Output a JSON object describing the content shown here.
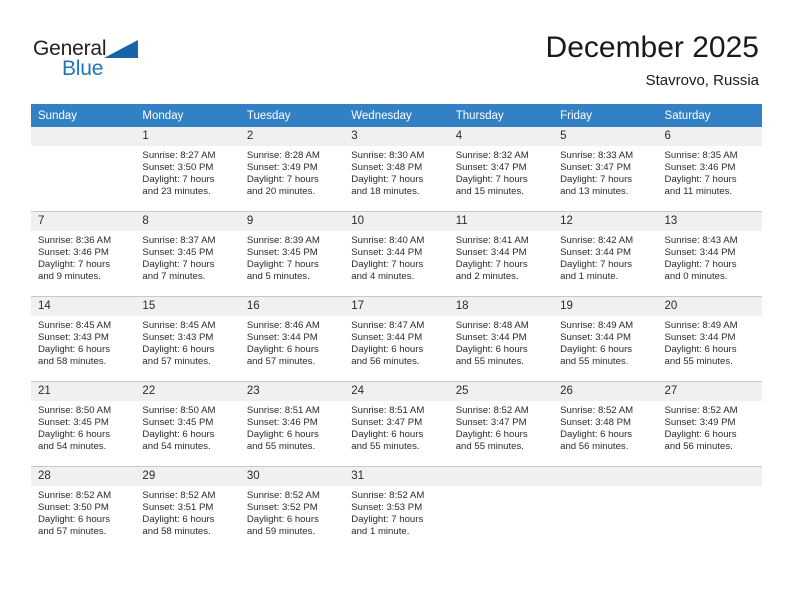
{
  "brand": {
    "line1": "General",
    "line2": "Blue",
    "triangle_icon": "triangle-right-icon",
    "color_text": "#231f20",
    "color_blue": "#1f74bd"
  },
  "header": {
    "title": "December 2025",
    "subtitle": "Stavrovo, Russia"
  },
  "theme": {
    "header_bg": "#3281c4",
    "header_text": "#ffffff",
    "daynum_bg": "#f0f0f0",
    "grid_line": "#c8c8c8",
    "body_text": "#2b2b2b"
  },
  "weekday_headers": [
    "Sunday",
    "Monday",
    "Tuesday",
    "Wednesday",
    "Thursday",
    "Friday",
    "Saturday"
  ],
  "labels": {
    "sunrise_prefix": "Sunrise:",
    "sunset_prefix": "Sunset:",
    "daylight_prefix": "Daylight:"
  },
  "weeks": [
    [
      {
        "day": "",
        "lines": []
      },
      {
        "day": "1",
        "lines": [
          "Sunrise: 8:27 AM",
          "Sunset: 3:50 PM",
          "Daylight: 7 hours",
          "and 23 minutes."
        ]
      },
      {
        "day": "2",
        "lines": [
          "Sunrise: 8:28 AM",
          "Sunset: 3:49 PM",
          "Daylight: 7 hours",
          "and 20 minutes."
        ]
      },
      {
        "day": "3",
        "lines": [
          "Sunrise: 8:30 AM",
          "Sunset: 3:48 PM",
          "Daylight: 7 hours",
          "and 18 minutes."
        ]
      },
      {
        "day": "4",
        "lines": [
          "Sunrise: 8:32 AM",
          "Sunset: 3:47 PM",
          "Daylight: 7 hours",
          "and 15 minutes."
        ]
      },
      {
        "day": "5",
        "lines": [
          "Sunrise: 8:33 AM",
          "Sunset: 3:47 PM",
          "Daylight: 7 hours",
          "and 13 minutes."
        ]
      },
      {
        "day": "6",
        "lines": [
          "Sunrise: 8:35 AM",
          "Sunset: 3:46 PM",
          "Daylight: 7 hours",
          "and 11 minutes."
        ]
      }
    ],
    [
      {
        "day": "7",
        "lines": [
          "Sunrise: 8:36 AM",
          "Sunset: 3:46 PM",
          "Daylight: 7 hours",
          "and 9 minutes."
        ]
      },
      {
        "day": "8",
        "lines": [
          "Sunrise: 8:37 AM",
          "Sunset: 3:45 PM",
          "Daylight: 7 hours",
          "and 7 minutes."
        ]
      },
      {
        "day": "9",
        "lines": [
          "Sunrise: 8:39 AM",
          "Sunset: 3:45 PM",
          "Daylight: 7 hours",
          "and 5 minutes."
        ]
      },
      {
        "day": "10",
        "lines": [
          "Sunrise: 8:40 AM",
          "Sunset: 3:44 PM",
          "Daylight: 7 hours",
          "and 4 minutes."
        ]
      },
      {
        "day": "11",
        "lines": [
          "Sunrise: 8:41 AM",
          "Sunset: 3:44 PM",
          "Daylight: 7 hours",
          "and 2 minutes."
        ]
      },
      {
        "day": "12",
        "lines": [
          "Sunrise: 8:42 AM",
          "Sunset: 3:44 PM",
          "Daylight: 7 hours",
          "and 1 minute."
        ]
      },
      {
        "day": "13",
        "lines": [
          "Sunrise: 8:43 AM",
          "Sunset: 3:44 PM",
          "Daylight: 7 hours",
          "and 0 minutes."
        ]
      }
    ],
    [
      {
        "day": "14",
        "lines": [
          "Sunrise: 8:45 AM",
          "Sunset: 3:43 PM",
          "Daylight: 6 hours",
          "and 58 minutes."
        ]
      },
      {
        "day": "15",
        "lines": [
          "Sunrise: 8:45 AM",
          "Sunset: 3:43 PM",
          "Daylight: 6 hours",
          "and 57 minutes."
        ]
      },
      {
        "day": "16",
        "lines": [
          "Sunrise: 8:46 AM",
          "Sunset: 3:44 PM",
          "Daylight: 6 hours",
          "and 57 minutes."
        ]
      },
      {
        "day": "17",
        "lines": [
          "Sunrise: 8:47 AM",
          "Sunset: 3:44 PM",
          "Daylight: 6 hours",
          "and 56 minutes."
        ]
      },
      {
        "day": "18",
        "lines": [
          "Sunrise: 8:48 AM",
          "Sunset: 3:44 PM",
          "Daylight: 6 hours",
          "and 55 minutes."
        ]
      },
      {
        "day": "19",
        "lines": [
          "Sunrise: 8:49 AM",
          "Sunset: 3:44 PM",
          "Daylight: 6 hours",
          "and 55 minutes."
        ]
      },
      {
        "day": "20",
        "lines": [
          "Sunrise: 8:49 AM",
          "Sunset: 3:44 PM",
          "Daylight: 6 hours",
          "and 55 minutes."
        ]
      }
    ],
    [
      {
        "day": "21",
        "lines": [
          "Sunrise: 8:50 AM",
          "Sunset: 3:45 PM",
          "Daylight: 6 hours",
          "and 54 minutes."
        ]
      },
      {
        "day": "22",
        "lines": [
          "Sunrise: 8:50 AM",
          "Sunset: 3:45 PM",
          "Daylight: 6 hours",
          "and 54 minutes."
        ]
      },
      {
        "day": "23",
        "lines": [
          "Sunrise: 8:51 AM",
          "Sunset: 3:46 PM",
          "Daylight: 6 hours",
          "and 55 minutes."
        ]
      },
      {
        "day": "24",
        "lines": [
          "Sunrise: 8:51 AM",
          "Sunset: 3:47 PM",
          "Daylight: 6 hours",
          "and 55 minutes."
        ]
      },
      {
        "day": "25",
        "lines": [
          "Sunrise: 8:52 AM",
          "Sunset: 3:47 PM",
          "Daylight: 6 hours",
          "and 55 minutes."
        ]
      },
      {
        "day": "26",
        "lines": [
          "Sunrise: 8:52 AM",
          "Sunset: 3:48 PM",
          "Daylight: 6 hours",
          "and 56 minutes."
        ]
      },
      {
        "day": "27",
        "lines": [
          "Sunrise: 8:52 AM",
          "Sunset: 3:49 PM",
          "Daylight: 6 hours",
          "and 56 minutes."
        ]
      }
    ],
    [
      {
        "day": "28",
        "lines": [
          "Sunrise: 8:52 AM",
          "Sunset: 3:50 PM",
          "Daylight: 6 hours",
          "and 57 minutes."
        ]
      },
      {
        "day": "29",
        "lines": [
          "Sunrise: 8:52 AM",
          "Sunset: 3:51 PM",
          "Daylight: 6 hours",
          "and 58 minutes."
        ]
      },
      {
        "day": "30",
        "lines": [
          "Sunrise: 8:52 AM",
          "Sunset: 3:52 PM",
          "Daylight: 6 hours",
          "and 59 minutes."
        ]
      },
      {
        "day": "31",
        "lines": [
          "Sunrise: 8:52 AM",
          "Sunset: 3:53 PM",
          "Daylight: 7 hours",
          "and 1 minute."
        ]
      },
      {
        "day": "",
        "lines": []
      },
      {
        "day": "",
        "lines": []
      },
      {
        "day": "",
        "lines": []
      }
    ]
  ]
}
